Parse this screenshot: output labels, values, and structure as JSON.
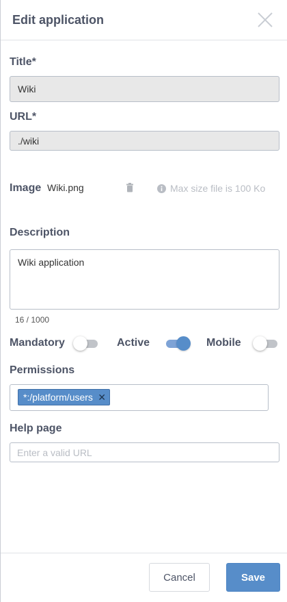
{
  "header": {
    "title": "Edit application",
    "close_icon": "close-icon"
  },
  "form": {
    "title_label": "Title*",
    "title_value": "Wiki",
    "url_label": "URL*",
    "url_value": "./wiki",
    "image_label": "Image",
    "image_file": "Wiki.png",
    "image_hint": "Max size file is 100 Ko",
    "description_label": "Description",
    "description_value": "Wiki application",
    "description_counter": "16 / 1000",
    "toggles": {
      "mandatory_label": "Mandatory",
      "mandatory_on": false,
      "active_label": "Active",
      "active_on": true,
      "mobile_label": "Mobile",
      "mobile_on": false
    },
    "permissions_label": "Permissions",
    "permissions": [
      "*:/platform/users"
    ],
    "help_label": "Help page",
    "help_placeholder": "Enter a valid URL",
    "help_value": ""
  },
  "footer": {
    "cancel_label": "Cancel",
    "save_label": "Save"
  },
  "colors": {
    "accent": "#578dc9",
    "text": "#4d5466",
    "hint": "#b9bdc4"
  }
}
